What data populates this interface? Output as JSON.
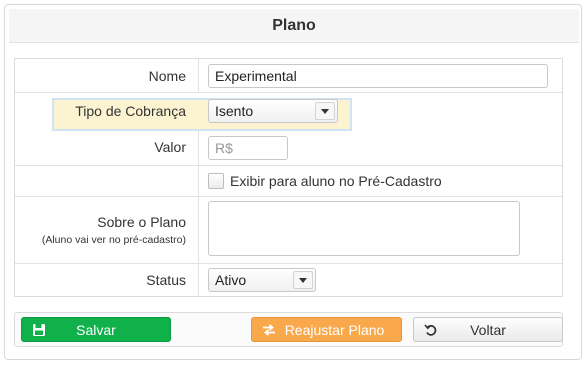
{
  "header": {
    "title": "Plano"
  },
  "form": {
    "nome": {
      "label": "Nome",
      "value": "Experimental"
    },
    "tipo_cobranca": {
      "label": "Tipo de Cobrança",
      "selected": "Isento",
      "highlight_color": "#fcf4d0"
    },
    "valor": {
      "label": "Valor",
      "placeholder": "R$"
    },
    "exibir": {
      "label": "Exibir para aluno no Pré-Cadastro",
      "checked": false
    },
    "sobre": {
      "label": "Sobre o Plano",
      "sublabel": "(Aluno vai ver no pré-cadastro)",
      "value": ""
    },
    "status": {
      "label": "Status",
      "selected": "Ativo"
    }
  },
  "footer": {
    "salvar": {
      "label": "Salvar",
      "icon": "floppy-disk-icon",
      "color": "#10b14b"
    },
    "reajustar": {
      "label": "Reajustar Plano",
      "icon": "swap-arrows-icon",
      "color": "#f9a94b"
    },
    "voltar": {
      "label": "Voltar",
      "icon": "undo-icon"
    }
  }
}
